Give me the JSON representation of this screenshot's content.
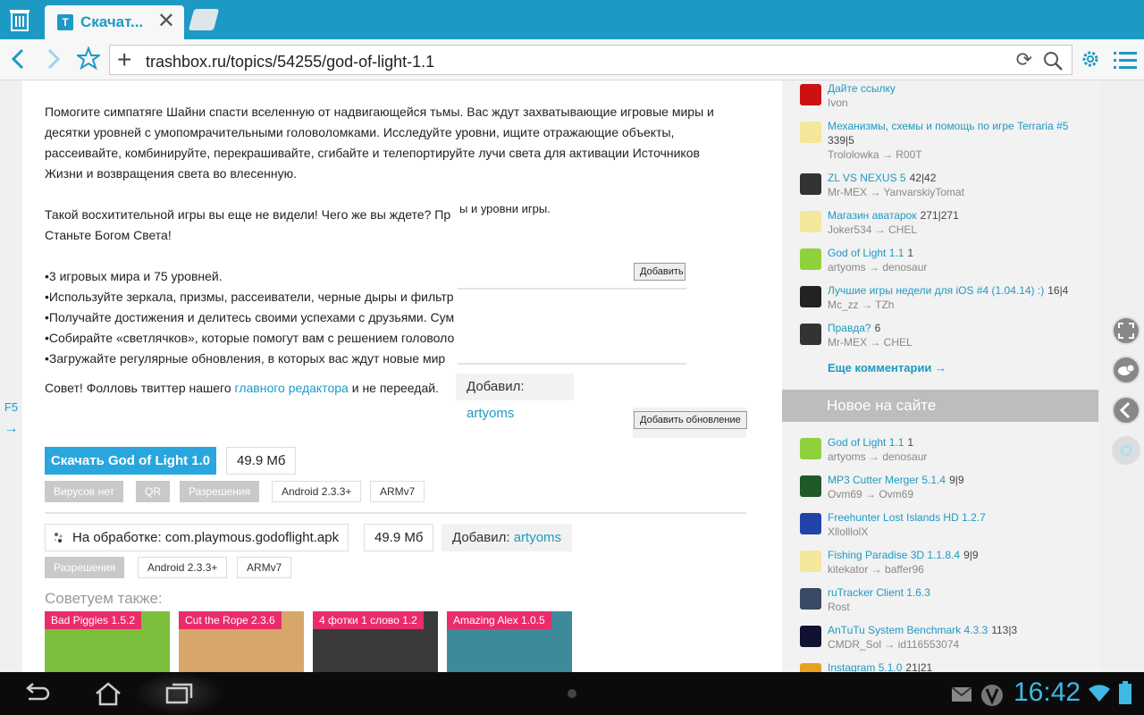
{
  "browser": {
    "tab_title": "Скачат...",
    "favicon_letter": "T",
    "url": "trashbox.ru/topics/54255/god-of-light-1.1"
  },
  "main": {
    "paragraph1": [
      "Помогите симпатяге Шайни спасти вселенную от надвигающейся тьмы. Вас ждут захватывающие игровые миры и",
      "десятки уровней с умопомрачительными головоломками. Исследуйте уровни, ищите отражающие объекты,",
      "рассеивайте, комбинируйте, перекрашивайте, сгибайте и телепортируйте лучи света для активации Источников",
      "Жизни и возвращения света во влесенную."
    ],
    "paragraph2": [
      "Такой восхитительной игры вы еще не видели! Чего же вы ждете? Пр                                                                                                           лениям!",
      "Станьте Богом Света!"
    ],
    "bullets": [
      "•3 игровых мира и 75 уровней.",
      "•Используйте зеркала, призмы, рассеиватели, черные дыры и фильтр",
      "•Получайте достижения и делитесь своими успехами с друзьями. Сум                                                                                                     в игре?",
      "•Собирайте «светлячков», которые помогут вам с решением головоло",
      "•Загружайте регулярные обновления, в которых вас ждут новые мир"
    ],
    "tip_prefix": "Совет! Фолловь твиттер нашего ",
    "tip_link": "главного редактора",
    "tip_suffix": " и не переедай.",
    "overlay_text": "ы и уровни игры.",
    "add_button_partial": "Добавить с",
    "add_update_button": "Добавить обновление",
    "added_label": "Добавил:",
    "added_user": "artyoms",
    "download": {
      "button": "Скачать God of Light 1.0",
      "size": "49.9 Мб",
      "tags": [
        "Вирусов нет",
        "QR",
        "Разрешения"
      ],
      "android": "Android 2.3.3+",
      "arch": "ARMv7"
    },
    "pending": {
      "label": "На обработке: com.playmous.godoflight.apk",
      "size": "49.9 Мб",
      "added_label": "Добавил:",
      "added_user": "artyoms",
      "tag_permissions": "Разрешения",
      "android": "Android 2.3.3+",
      "arch": "ARMv7"
    },
    "recommend_title": "Советуем также:",
    "recommend": [
      {
        "label": "Bad Piggies 1.5.2",
        "color": "#7cbf3c"
      },
      {
        "label": "Cut the Rope 2.3.6",
        "color": "#d6a66a"
      },
      {
        "label": "4 фотки 1 слово 1.2",
        "color": "#3a3a3a"
      },
      {
        "label": "Amazing Alex 1.0.5",
        "color": "#3d8a9a"
      }
    ]
  },
  "sidebar": {
    "comments": [
      {
        "title": "Дайте ссылку",
        "count": "",
        "meta": "Ivon",
        "avatar": "#cc1111"
      },
      {
        "title": "Механизмы, схемы и помощь по игре Terraria #5",
        "count": "",
        "meta2": "339|5",
        "meta": "Trololowka → R00T",
        "avatar": "#f2e79a"
      },
      {
        "title": "ZL VS NEXUS 5",
        "count": "42|42",
        "meta": "Mr-MEX → YanvarskiyTomat",
        "avatar": "#333333"
      },
      {
        "title": "Магазин аватарок",
        "count": "271|271",
        "meta": "Joker534 → CHEL",
        "avatar": "#f2e79a"
      },
      {
        "title": "God of Light 1.1",
        "count": "1",
        "meta": "artyoms → denosaur",
        "avatar": "#8fd13a"
      },
      {
        "title": "Лучшие игры недели для iOS #4 (1.04.14) :)",
        "count": "16|4",
        "meta": "Mc_zz → TZh",
        "avatar": "#222222"
      },
      {
        "title": "Правда?",
        "count": "6",
        "meta": "Mr-MEX → CHEL",
        "avatar": "#333333"
      }
    ],
    "more_comments": "Еще комментарии →",
    "new_header": "Новое на сайте",
    "new_items": [
      {
        "title": "God of Light 1.1",
        "count": "1",
        "meta": "artyoms → denosaur",
        "avatar": "#8fd13a"
      },
      {
        "title": "MP3 Cutter Merger 5.1.4",
        "count": "9|9",
        "meta": "Ovm69 → Ovm69",
        "avatar": "#1e5a2a"
      },
      {
        "title": "Freehunter Lost Islands HD 1.2.7",
        "count": "",
        "meta": "XllolllolX",
        "avatar": "#2244aa"
      },
      {
        "title": "Fishing Paradise 3D 1.1.8.4",
        "count": "9|9",
        "meta": "kitekator → baffer96",
        "avatar": "#f2e79a"
      },
      {
        "title": "ruTracker Client 1.6.3",
        "count": "",
        "meta": "Rost",
        "avatar": "#3a4a66"
      },
      {
        "title": "AnTuTu System Benchmark 4.3.3",
        "count": "113|3",
        "meta": "CMDR_Sol → id116553074",
        "avatar": "#111133"
      },
      {
        "title": "Instagram 5.1.0",
        "count": "21|21",
        "meta": "",
        "avatar": "#e8a020"
      }
    ]
  },
  "left_edge": {
    "label": "F5",
    "arrow": "→"
  },
  "system": {
    "clock": "16:42"
  }
}
